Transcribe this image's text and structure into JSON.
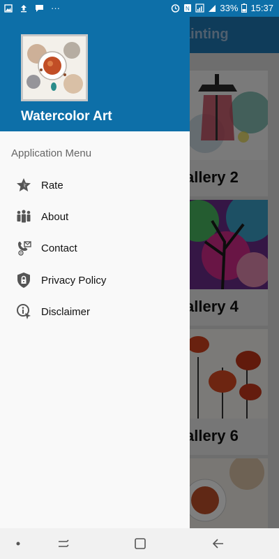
{
  "status_bar": {
    "battery": "33%",
    "time": "15:37",
    "more_dots": "···"
  },
  "app_bar": {
    "title_partial": "ainting"
  },
  "drawer": {
    "app_name": "Watercolor Art",
    "section_title": "Application Menu",
    "items": [
      {
        "label": "Rate",
        "icon": "star-icon"
      },
      {
        "label": "About",
        "icon": "group-icon"
      },
      {
        "label": "Contact",
        "icon": "phone-contact-icon"
      },
      {
        "label": "Privacy Policy",
        "icon": "shield-lock-icon"
      },
      {
        "label": "Disclaimer",
        "icon": "info-icon"
      }
    ]
  },
  "background_list": {
    "cards": [
      {
        "label": "allery 2"
      },
      {
        "label": "allery 4"
      },
      {
        "label": "allery 6"
      }
    ]
  },
  "nav_bar": {
    "buttons": [
      "dot",
      "recents",
      "home",
      "back"
    ]
  },
  "colors": {
    "primary": "#0d6fa8",
    "app_bar": "#1f78b4",
    "drawer_bg": "#f9f9f9"
  }
}
